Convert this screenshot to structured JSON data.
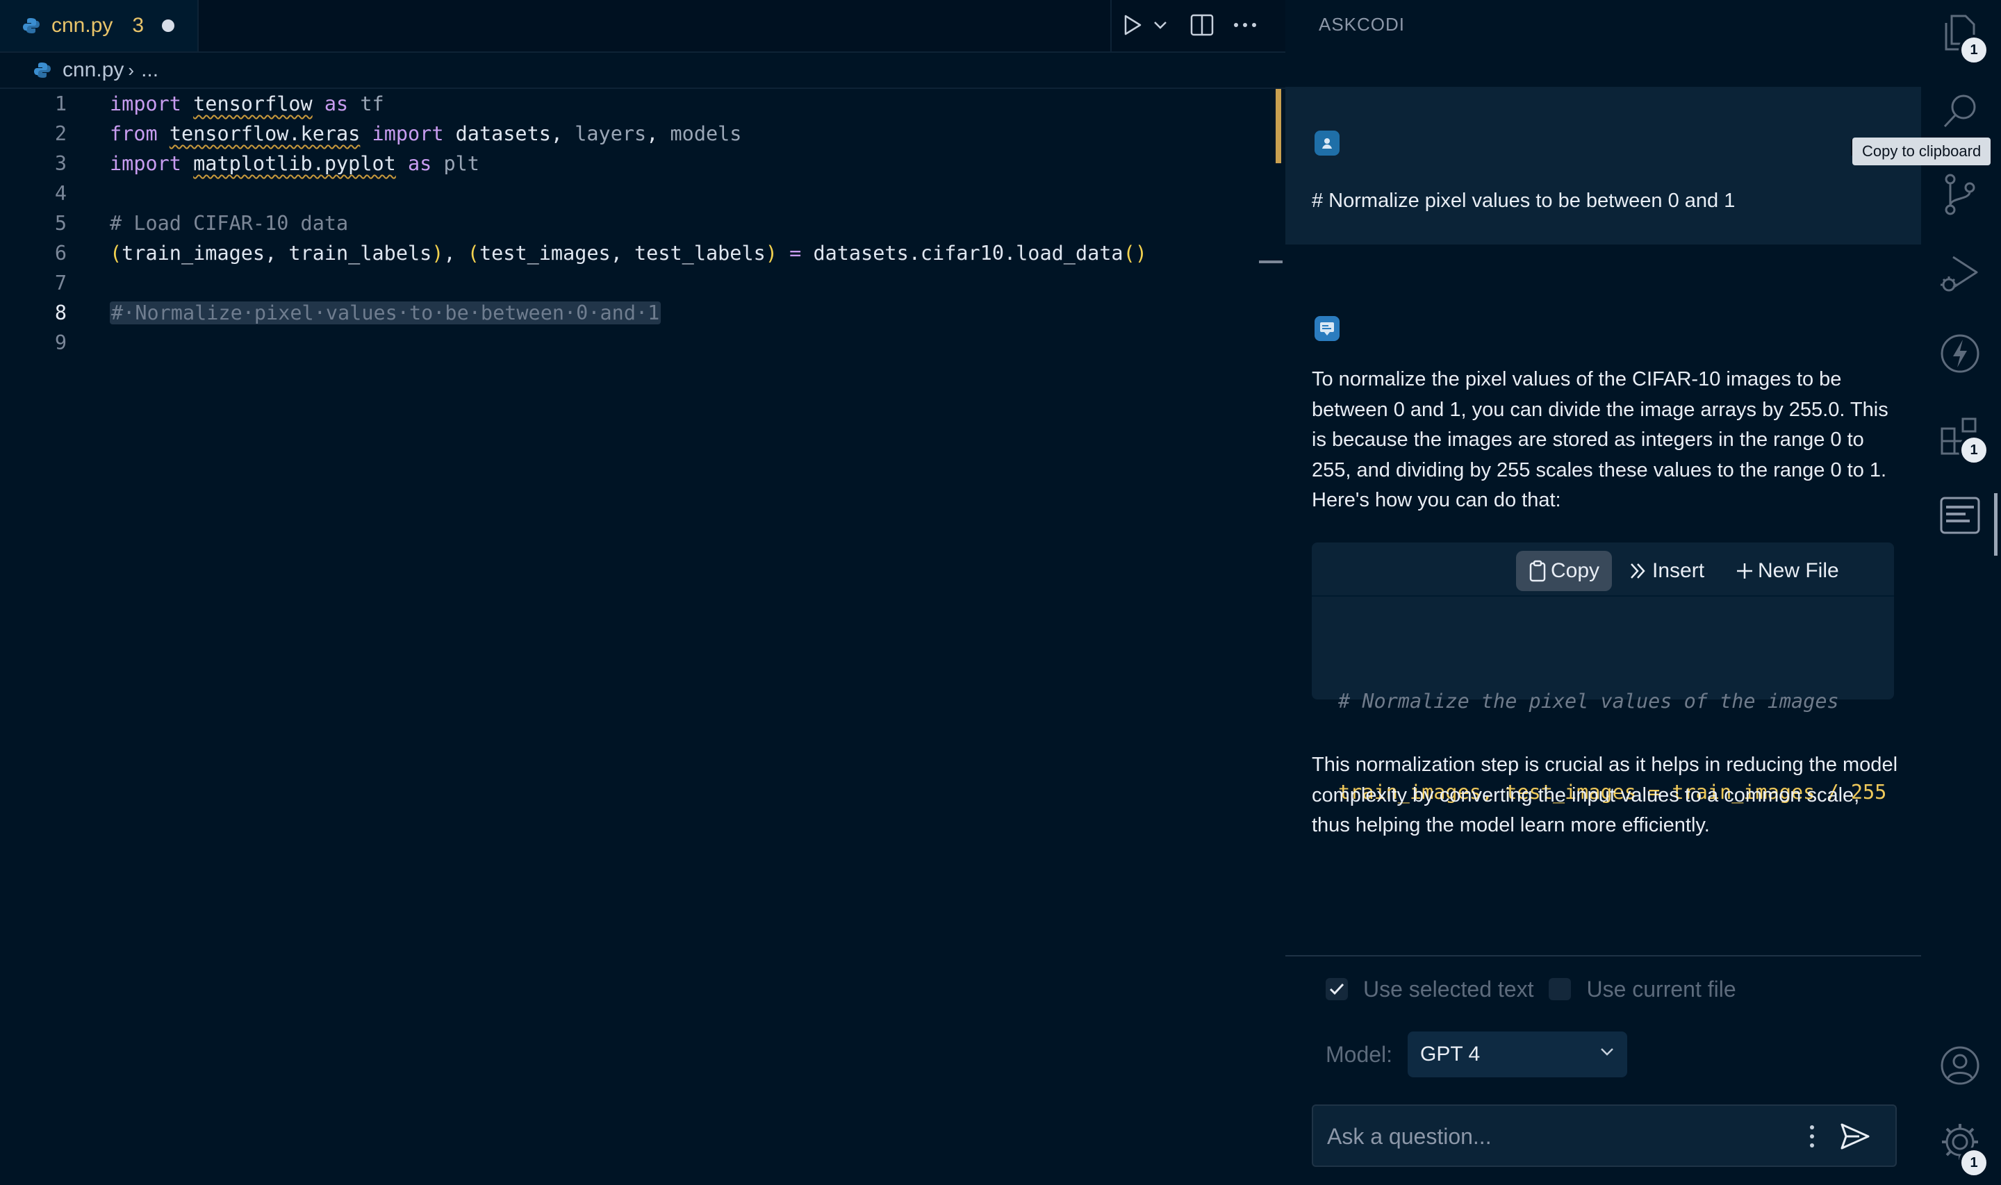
{
  "colors": {
    "background": "#001425",
    "panel_message": "#0b2337",
    "keyword": "#c89cf0",
    "comment": "#7c8797",
    "modified_tab": "#e9c46a",
    "bracket": "#f2d24f"
  },
  "editor": {
    "tab": {
      "filename": "cnn.py",
      "problem_count": "3",
      "modified_icon": "dot-icon"
    },
    "breadcrumb": {
      "file": "cnn.py",
      "more": "..."
    },
    "actions": [
      "run-icon",
      "chevron-down-icon",
      "split-editor-icon",
      "more-icon"
    ],
    "lines": [
      {
        "number": "1",
        "tokens": [
          {
            "t": "import",
            "c": "kw"
          },
          {
            "t": " ",
            "c": "id"
          },
          {
            "t": "tensorflow",
            "c": "id squig"
          },
          {
            "t": " ",
            "c": "id"
          },
          {
            "t": "as",
            "c": "kw"
          },
          {
            "t": " tf",
            "c": "dim"
          }
        ]
      },
      {
        "number": "2",
        "tokens": [
          {
            "t": "from",
            "c": "kw"
          },
          {
            "t": " ",
            "c": "id"
          },
          {
            "t": "tensorflow.keras",
            "c": "id squig"
          },
          {
            "t": " ",
            "c": "id"
          },
          {
            "t": "import",
            "c": "kw"
          },
          {
            "t": " datasets, ",
            "c": "id"
          },
          {
            "t": "layers",
            "c": "dim"
          },
          {
            "t": ", ",
            "c": "id"
          },
          {
            "t": "models",
            "c": "dim"
          }
        ]
      },
      {
        "number": "3",
        "tokens": [
          {
            "t": "import",
            "c": "kw"
          },
          {
            "t": " ",
            "c": "id"
          },
          {
            "t": "matplotlib.pyplot",
            "c": "id squig"
          },
          {
            "t": " ",
            "c": "id"
          },
          {
            "t": "as",
            "c": "kw"
          },
          {
            "t": " plt",
            "c": "dim"
          }
        ]
      },
      {
        "number": "4",
        "tokens": []
      },
      {
        "number": "5",
        "tokens": [
          {
            "t": "# Load CIFAR-10 data",
            "c": "cm"
          }
        ]
      },
      {
        "number": "6",
        "tokens": [
          {
            "t": "(",
            "c": "par"
          },
          {
            "t": "train_images, train_labels",
            "c": "id"
          },
          {
            "t": ")",
            "c": "par"
          },
          {
            "t": ", ",
            "c": "id"
          },
          {
            "t": "(",
            "c": "par"
          },
          {
            "t": "test_images, test_labels",
            "c": "id"
          },
          {
            "t": ")",
            "c": "par"
          },
          {
            "t": " ",
            "c": "id"
          },
          {
            "t": "=",
            "c": "kw"
          },
          {
            "t": " datasets.cifar10.load_data",
            "c": "id"
          },
          {
            "t": "()",
            "c": "par"
          }
        ]
      },
      {
        "number": "7",
        "tokens": []
      },
      {
        "number": "8",
        "active": true,
        "tokens": [
          {
            "t": "#·Normalize·pixel·values·to·be·between·0·and·1",
            "c": "sel"
          }
        ]
      },
      {
        "number": "9",
        "tokens": []
      }
    ]
  },
  "panel": {
    "title": "ASKCODI",
    "user_message": "# Normalize pixel values to be between 0 and 1",
    "bot_paragraph_1": "To normalize the pixel values of the CIFAR-10 images to be between 0 and 1, you can divide the image arrays by 255.0. This is because the images are stored as integers in the range 0 to 255, and dividing by 255 scales these values to the range 0 to 1. Here's how you can do that:",
    "code_actions": {
      "copy": "Copy",
      "insert": "Insert",
      "new_file": "New File"
    },
    "code_comment": "# Normalize the pixel values of the images",
    "code_line": "train_images, test_images = train_images / 255",
    "bot_paragraph_2": "This normalization step is crucial as it helps in reducing the model complexity by converting the input values to a common scale, thus helping the model learn more efficiently.",
    "options": {
      "use_selected_text": "Use selected text",
      "use_selected_checked": true,
      "use_current_file": "Use current file",
      "use_current_checked": false
    },
    "model_label": "Model:",
    "model_value": "GPT 4",
    "ask_placeholder": "Ask a question..."
  },
  "activity_bar": {
    "items": [
      {
        "icon": "explorer-icon",
        "badge": "1"
      },
      {
        "icon": "search-icon",
        "badge": ""
      },
      {
        "icon": "source-control-icon",
        "badge": ""
      },
      {
        "icon": "run-debug-icon",
        "badge": ""
      },
      {
        "icon": "lightning-icon",
        "badge": ""
      },
      {
        "icon": "extensions-icon",
        "badge": "1"
      },
      {
        "icon": "askcodi-icon",
        "badge": ""
      },
      {
        "icon": "account-icon",
        "badge": ""
      },
      {
        "icon": "settings-gear-icon",
        "badge": "1"
      }
    ],
    "tooltip": "Copy to clipboard"
  }
}
